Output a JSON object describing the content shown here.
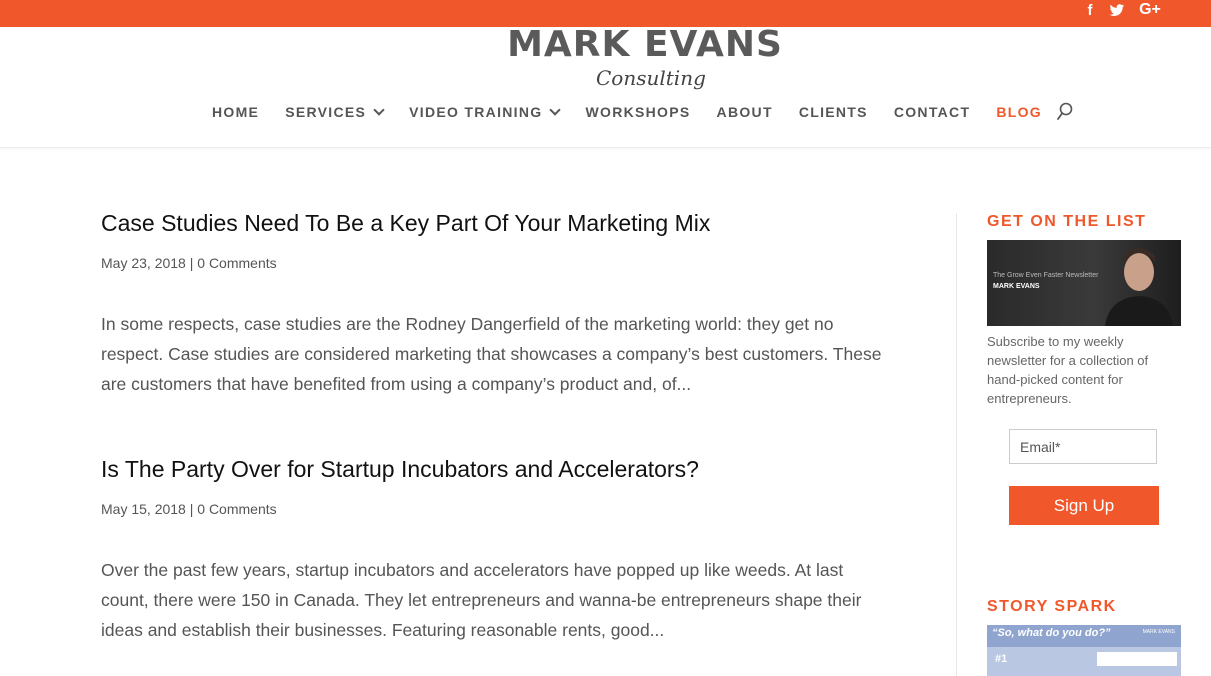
{
  "social": {
    "facebook": "f",
    "twitter": "twitter-icon",
    "google_plus": "G+"
  },
  "logo": {
    "main": "MARK EVANS",
    "sub": "Consulting"
  },
  "nav": {
    "items": [
      {
        "label": "HOME"
      },
      {
        "label": "SERVICES"
      },
      {
        "label": "VIDEO TRAINING"
      },
      {
        "label": "WORKSHOPS"
      },
      {
        "label": "ABOUT"
      },
      {
        "label": "CLIENTS"
      },
      {
        "label": "CONTACT"
      },
      {
        "label": "BLOG"
      }
    ]
  },
  "posts": [
    {
      "title": "Case Studies Need To Be a Key Part Of Your Marketing Mix",
      "date": "May 23, 2018",
      "comments": "0 Comments",
      "excerpt": "In some respects, case studies are the Rodney Dangerfield of the marketing world: they get no respect. Case studies are considered marketing that showcases a company’s best customers. These are customers that have benefited from using a company’s product and, of..."
    },
    {
      "title": "Is The Party Over for Startup Incubators and Accelerators?",
      "date": "May 15, 2018",
      "comments": "0 Comments",
      "excerpt": "Over the past few years, startup incubators and accelerators have popped up like weeds. At last count, there were 150 in Canada. They let entrepreneurs and wanna-be entrepreneurs shape their ideas and establish their businesses. Featuring reasonable rents, good..."
    }
  ],
  "sidebar": {
    "newsletter": {
      "title": "GET ON THE LIST",
      "image_small": "The Grow Even Faster Newsletter",
      "image_name": "MARK EVANS",
      "text": "Subscribe to my weekly newsletter for a collection of hand-picked content for entrepreneurs.",
      "email_placeholder": "Email*",
      "button": "Sign Up"
    },
    "story": {
      "title": "STORY SPARK",
      "image_title": "“So, what do you do?”",
      "image_brand": "MARK EVANS",
      "image_num": "#1"
    }
  },
  "colors": {
    "accent": "#f0582c",
    "text": "#555555",
    "title": "#111111"
  }
}
